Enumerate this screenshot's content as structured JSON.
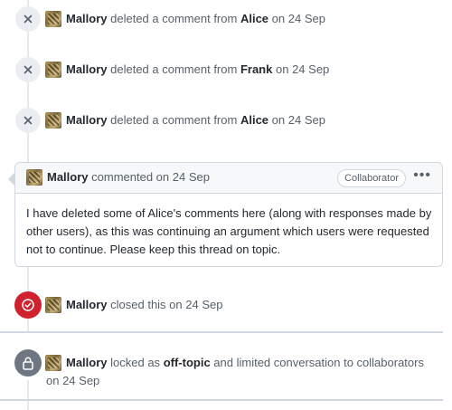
{
  "events": [
    {
      "user": "Mallory",
      "action": "deleted a comment from",
      "target": "Alice",
      "date_prefix": "on",
      "date": "24 Sep"
    },
    {
      "user": "Mallory",
      "action": "deleted a comment from",
      "target": "Frank",
      "date_prefix": "on",
      "date": "24 Sep"
    },
    {
      "user": "Mallory",
      "action": "deleted a comment from",
      "target": "Alice",
      "date_prefix": "on",
      "date": "24 Sep"
    }
  ],
  "comment": {
    "author": "Mallory",
    "action": "commented on 24 Sep",
    "badge": "Collaborator",
    "menu": "•••",
    "body": "I have deleted some of Alice's comments here (along with responses made by other users), as this was continuing an argument which users were requested not to continue. Please keep this thread on topic."
  },
  "closed_event": {
    "user": "Mallory",
    "text": "closed this on 24 Sep"
  },
  "locked_event": {
    "user": "Mallory",
    "text_before": "locked as",
    "reason": "off-topic",
    "text_after": "and limited conversation to collaborators",
    "date_line": "on 24 Sep"
  },
  "colors": {
    "closed_badge": "#cf222e",
    "lock_badge": "#6e7781",
    "delete_badge": "#eaeef2"
  }
}
